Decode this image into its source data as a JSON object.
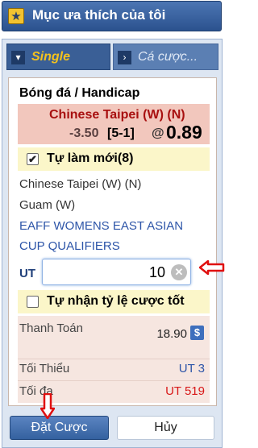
{
  "header": {
    "title": "Mục ưa thích của tôi",
    "icon": "star-icon"
  },
  "tabs": [
    {
      "label": "Single",
      "active": true,
      "icon": "chevron-down-icon"
    },
    {
      "label": "Cá cược...",
      "active": false,
      "icon": "chevron-right-icon"
    }
  ],
  "bet": {
    "sport": "Bóng đá / Handicap",
    "selection": "Chinese Taipei (W) (N)",
    "handicap": "-3.50",
    "score": "[5-1]",
    "at": "@",
    "odds": "0.89",
    "auto_refresh": {
      "label": "Tự làm mới(8)",
      "checked": true
    },
    "home_team": "Chinese Taipei (W) (N)",
    "away_team": "Guam (W)",
    "league": "EAFF WOMENS EAST ASIAN CUP QUALIFIERS",
    "stake_label": "UT",
    "stake_value": "10",
    "accept_better_odds": {
      "label": "Tự nhận tỷ lệ cược tốt",
      "checked": false
    }
  },
  "summary": {
    "payout_label": "Thanh Toán",
    "payout_value": "18.90",
    "payout_icon": "dollar-icon",
    "min_label": "Tối Thiểu",
    "min_value": "UT 3",
    "max_label": "Tối đa",
    "max_value": "UT 519"
  },
  "actions": {
    "place_bet": "Đặt Cược",
    "cancel": "Hủy"
  },
  "colors": {
    "header": "#3a66a6",
    "accent_red": "#a81010",
    "link_blue": "#2d55a8",
    "highlight": "#fbf6c9",
    "annotation_arrow": "#e01010"
  }
}
